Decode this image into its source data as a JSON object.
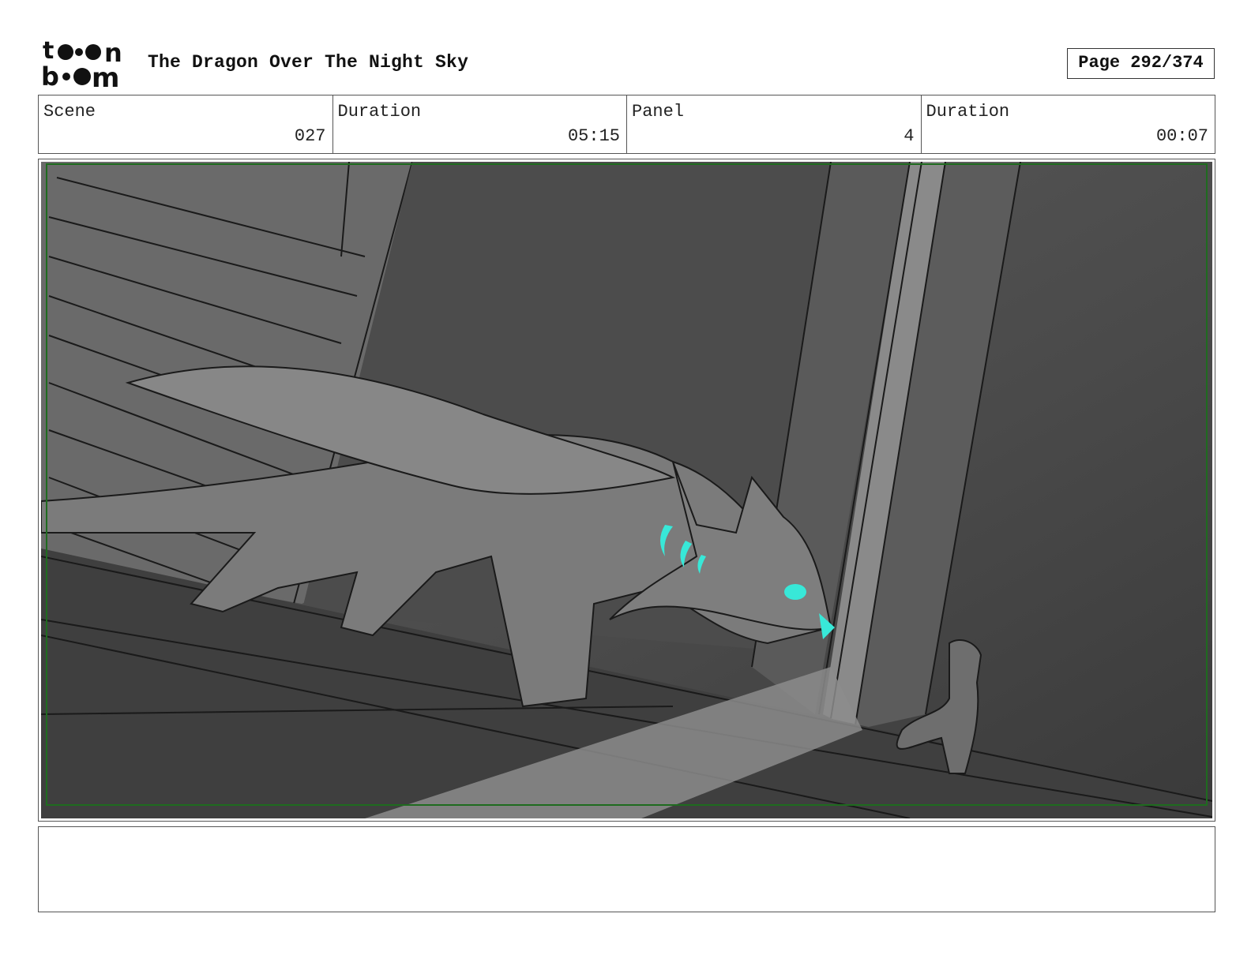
{
  "header": {
    "logo_text": "toon boom",
    "title": "The Dragon Over The Night Sky",
    "page_label": "Page 292/374"
  },
  "info": {
    "scene_label": "Scene",
    "scene_value": "027",
    "scene_duration_label": "Duration",
    "scene_duration_value": "05:15",
    "panel_label": "Panel",
    "panel_value": "4",
    "panel_duration_label": "Duration",
    "panel_duration_value": "00:07"
  },
  "notes": {
    "text": ""
  },
  "colors": {
    "safe_frame": "#1f6b1f",
    "glow": "#38e8d8",
    "ink": "#1a1a1a"
  }
}
